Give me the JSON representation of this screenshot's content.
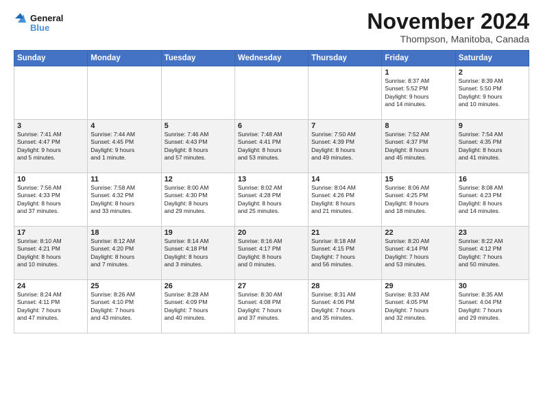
{
  "header": {
    "logo_line1": "General",
    "logo_line2": "Blue",
    "month": "November 2024",
    "location": "Thompson, Manitoba, Canada"
  },
  "columns": [
    "Sunday",
    "Monday",
    "Tuesday",
    "Wednesday",
    "Thursday",
    "Friday",
    "Saturday"
  ],
  "rows": [
    [
      {
        "day": "",
        "info": ""
      },
      {
        "day": "",
        "info": ""
      },
      {
        "day": "",
        "info": ""
      },
      {
        "day": "",
        "info": ""
      },
      {
        "day": "",
        "info": ""
      },
      {
        "day": "1",
        "info": "Sunrise: 8:37 AM\nSunset: 5:52 PM\nDaylight: 9 hours\nand 14 minutes."
      },
      {
        "day": "2",
        "info": "Sunrise: 8:39 AM\nSunset: 5:50 PM\nDaylight: 9 hours\nand 10 minutes."
      }
    ],
    [
      {
        "day": "3",
        "info": "Sunrise: 7:41 AM\nSunset: 4:47 PM\nDaylight: 9 hours\nand 5 minutes."
      },
      {
        "day": "4",
        "info": "Sunrise: 7:44 AM\nSunset: 4:45 PM\nDaylight: 9 hours\nand 1 minute."
      },
      {
        "day": "5",
        "info": "Sunrise: 7:46 AM\nSunset: 4:43 PM\nDaylight: 8 hours\nand 57 minutes."
      },
      {
        "day": "6",
        "info": "Sunrise: 7:48 AM\nSunset: 4:41 PM\nDaylight: 8 hours\nand 53 minutes."
      },
      {
        "day": "7",
        "info": "Sunrise: 7:50 AM\nSunset: 4:39 PM\nDaylight: 8 hours\nand 49 minutes."
      },
      {
        "day": "8",
        "info": "Sunrise: 7:52 AM\nSunset: 4:37 PM\nDaylight: 8 hours\nand 45 minutes."
      },
      {
        "day": "9",
        "info": "Sunrise: 7:54 AM\nSunset: 4:35 PM\nDaylight: 8 hours\nand 41 minutes."
      }
    ],
    [
      {
        "day": "10",
        "info": "Sunrise: 7:56 AM\nSunset: 4:33 PM\nDaylight: 8 hours\nand 37 minutes."
      },
      {
        "day": "11",
        "info": "Sunrise: 7:58 AM\nSunset: 4:32 PM\nDaylight: 8 hours\nand 33 minutes."
      },
      {
        "day": "12",
        "info": "Sunrise: 8:00 AM\nSunset: 4:30 PM\nDaylight: 8 hours\nand 29 minutes."
      },
      {
        "day": "13",
        "info": "Sunrise: 8:02 AM\nSunset: 4:28 PM\nDaylight: 8 hours\nand 25 minutes."
      },
      {
        "day": "14",
        "info": "Sunrise: 8:04 AM\nSunset: 4:26 PM\nDaylight: 8 hours\nand 21 minutes."
      },
      {
        "day": "15",
        "info": "Sunrise: 8:06 AM\nSunset: 4:25 PM\nDaylight: 8 hours\nand 18 minutes."
      },
      {
        "day": "16",
        "info": "Sunrise: 8:08 AM\nSunset: 4:23 PM\nDaylight: 8 hours\nand 14 minutes."
      }
    ],
    [
      {
        "day": "17",
        "info": "Sunrise: 8:10 AM\nSunset: 4:21 PM\nDaylight: 8 hours\nand 10 minutes."
      },
      {
        "day": "18",
        "info": "Sunrise: 8:12 AM\nSunset: 4:20 PM\nDaylight: 8 hours\nand 7 minutes."
      },
      {
        "day": "19",
        "info": "Sunrise: 8:14 AM\nSunset: 4:18 PM\nDaylight: 8 hours\nand 3 minutes."
      },
      {
        "day": "20",
        "info": "Sunrise: 8:16 AM\nSunset: 4:17 PM\nDaylight: 8 hours\nand 0 minutes."
      },
      {
        "day": "21",
        "info": "Sunrise: 8:18 AM\nSunset: 4:15 PM\nDaylight: 7 hours\nand 56 minutes."
      },
      {
        "day": "22",
        "info": "Sunrise: 8:20 AM\nSunset: 4:14 PM\nDaylight: 7 hours\nand 53 minutes."
      },
      {
        "day": "23",
        "info": "Sunrise: 8:22 AM\nSunset: 4:12 PM\nDaylight: 7 hours\nand 50 minutes."
      }
    ],
    [
      {
        "day": "24",
        "info": "Sunrise: 8:24 AM\nSunset: 4:11 PM\nDaylight: 7 hours\nand 47 minutes."
      },
      {
        "day": "25",
        "info": "Sunrise: 8:26 AM\nSunset: 4:10 PM\nDaylight: 7 hours\nand 43 minutes."
      },
      {
        "day": "26",
        "info": "Sunrise: 8:28 AM\nSunset: 4:09 PM\nDaylight: 7 hours\nand 40 minutes."
      },
      {
        "day": "27",
        "info": "Sunrise: 8:30 AM\nSunset: 4:08 PM\nDaylight: 7 hours\nand 37 minutes."
      },
      {
        "day": "28",
        "info": "Sunrise: 8:31 AM\nSunset: 4:06 PM\nDaylight: 7 hours\nand 35 minutes."
      },
      {
        "day": "29",
        "info": "Sunrise: 8:33 AM\nSunset: 4:05 PM\nDaylight: 7 hours\nand 32 minutes."
      },
      {
        "day": "30",
        "info": "Sunrise: 8:35 AM\nSunset: 4:04 PM\nDaylight: 7 hours\nand 29 minutes."
      }
    ]
  ]
}
